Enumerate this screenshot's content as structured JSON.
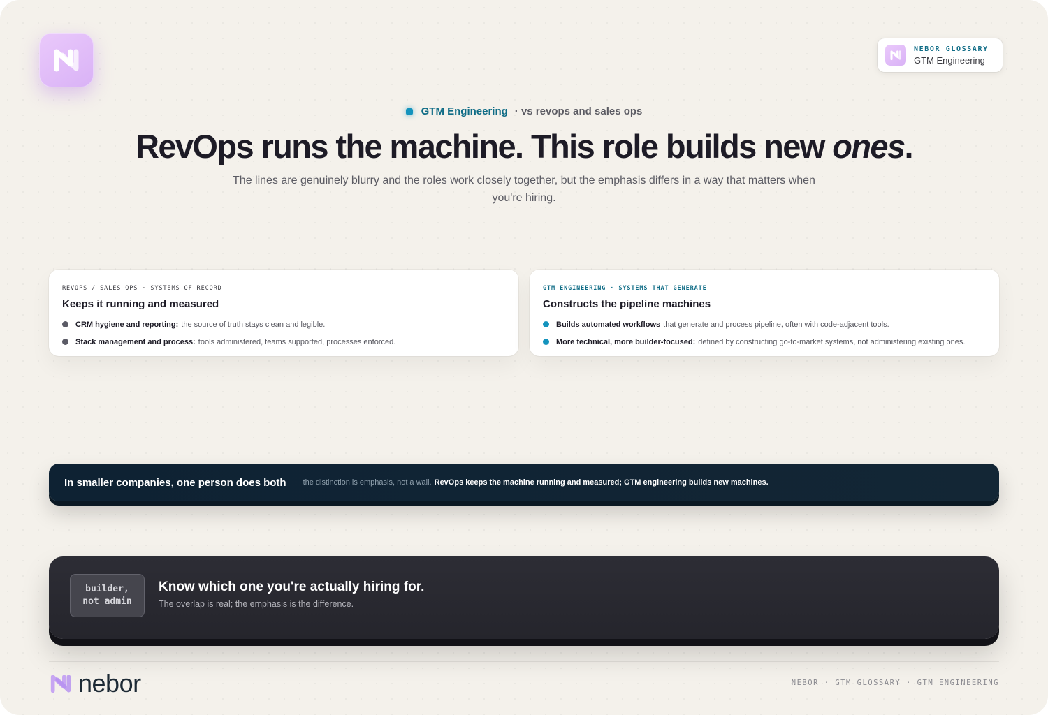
{
  "header": {
    "glossary_kicker": "NEBOR GLOSSARY",
    "glossary_name": "GTM Engineering",
    "eyebrow_topic": "GTM Engineering",
    "eyebrow_sub": "· vs revops and sales ops",
    "headline_main": "RevOps runs the machine. This role builds new ",
    "headline_emph": "ones",
    "headline_end": ".",
    "lede": "The lines are genuinely blurry and the roles work closely together, but the emphasis differs in a way that matters when you're hiring."
  },
  "cards": [
    {
      "label": "REVOPS / SALES OPS · SYSTEMS OF RECORD",
      "title": "Keeps it running and measured",
      "items": [
        {
          "strong": "CRM hygiene and reporting:",
          "text": "the source of truth stays clean and legible."
        },
        {
          "strong": "Stack management and process:",
          "text": "tools administered, teams supported, processes enforced."
        }
      ]
    },
    {
      "label": "GTM ENGINEERING · SYSTEMS THAT GENERATE",
      "title": "Constructs the pipeline machines",
      "items": [
        {
          "strong": "Builds automated workflows",
          "text": "that generate and process pipeline, often with code-adjacent tools."
        },
        {
          "strong": "More technical, more builder-focused:",
          "text": "defined by constructing go-to-market systems, not administering existing ones."
        }
      ]
    }
  ],
  "strip": {
    "title": "In smaller companies, one person does both",
    "note": "the distinction is emphasis, not a wall.",
    "strong": "RevOps keeps the machine running and measured; GTM engineering builds new machines."
  },
  "cta": {
    "chip": "builder,\nnot admin",
    "title": "Know which one you're actually hiring for.",
    "subtitle": "The overlap is real; the emphasis is the difference."
  },
  "footer": {
    "brand": "nebor",
    "meta": "NEBOR · GTM GLOSSARY · GTM ENGINEERING"
  },
  "colors": {
    "accent_teal": "#0f6c86",
    "accent_blue_dot": "#1493bd",
    "brand_lilac": "#d9b2f6",
    "ink": "#1d1b26"
  },
  "icons": {
    "logo": "nebor-n-logo-icon"
  }
}
